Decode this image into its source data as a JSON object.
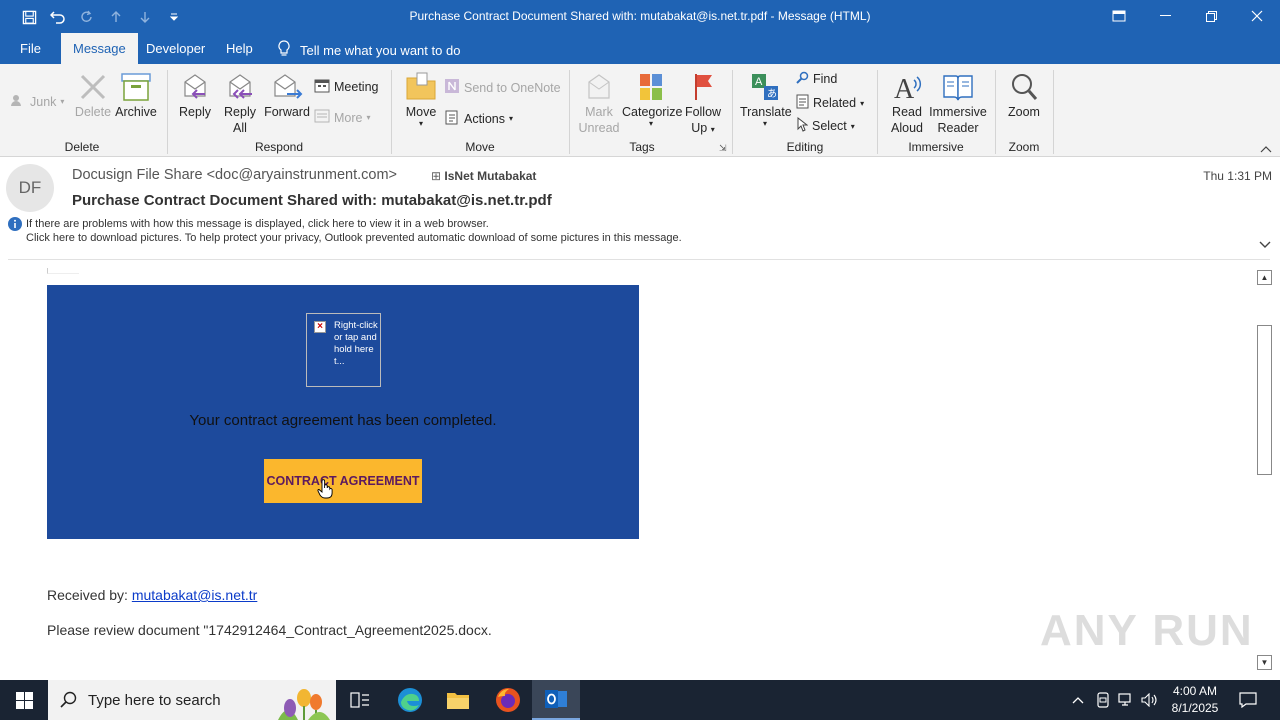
{
  "window": {
    "title": "Purchase Contract Document Shared with: mutabakat@is.net.tr.pdf  -  Message (HTML)"
  },
  "tabs": [
    {
      "label": "File"
    },
    {
      "label": "Message"
    },
    {
      "label": "Developer"
    },
    {
      "label": "Help"
    }
  ],
  "tell_me": "Tell me what you want to do",
  "ribbon": {
    "delete_group": {
      "junk": "Junk",
      "delete": "Delete",
      "archive": "Archive",
      "label": "Delete"
    },
    "respond_group": {
      "reply": "Reply",
      "reply_all_1": "Reply",
      "reply_all_2": "All",
      "forward": "Forward",
      "meeting": "Meeting",
      "more": "More",
      "label": "Respond"
    },
    "move_group": {
      "move": "Move",
      "onenote": "Send to OneNote",
      "actions": "Actions",
      "label": "Move"
    },
    "tags_group": {
      "mark_1": "Mark",
      "mark_2": "Unread",
      "categorize": "Categorize",
      "follow_1": "Follow",
      "follow_2": "Up",
      "label": "Tags"
    },
    "editing_group": {
      "translate": "Translate",
      "find": "Find",
      "related": "Related",
      "select": "Select",
      "label": "Editing"
    },
    "immersive_group": {
      "read_1": "Read",
      "read_2": "Aloud",
      "reader_1": "Immersive",
      "reader_2": "Reader",
      "label": "Immersive"
    },
    "zoom_group": {
      "zoom": "Zoom",
      "label": "Zoom"
    }
  },
  "header": {
    "avatar_initials": "DF",
    "sender": "Docusign File Share <doc@aryainstrunment.com>",
    "to": "IsNet Mutabakat",
    "date": "Thu 1:31 PM",
    "subject": "Purchase Contract Document Shared with: mutabakat@is.net.tr.pdf",
    "info_line_1": "If there are problems with how this message is displayed, click here to view it in a web browser.",
    "info_line_2": "Click here to download pictures. To help protect your privacy, Outlook prevented automatic download of some pictures in this message."
  },
  "body": {
    "broken_image_alt": "Right-click or tap and hold here t...",
    "message": "Your contract agreement has been completed.",
    "cta_label": "CONTRACT AGREEMENT",
    "received_label": "Received by: ",
    "received_email": "mutabakat@is.net.tr",
    "review_text": "Please review document \"1742912464_Contract_Agreement2025.docx."
  },
  "watermark": "ANY RUN",
  "taskbar": {
    "search_placeholder": "Type here to search",
    "time": "4:00 AM",
    "date": "8/1/2025"
  },
  "colors": {
    "titlebar": "#1f63b4",
    "email_box": "#1d4a9c",
    "cta": "#fbb72d",
    "taskbar": "#1a2433"
  }
}
